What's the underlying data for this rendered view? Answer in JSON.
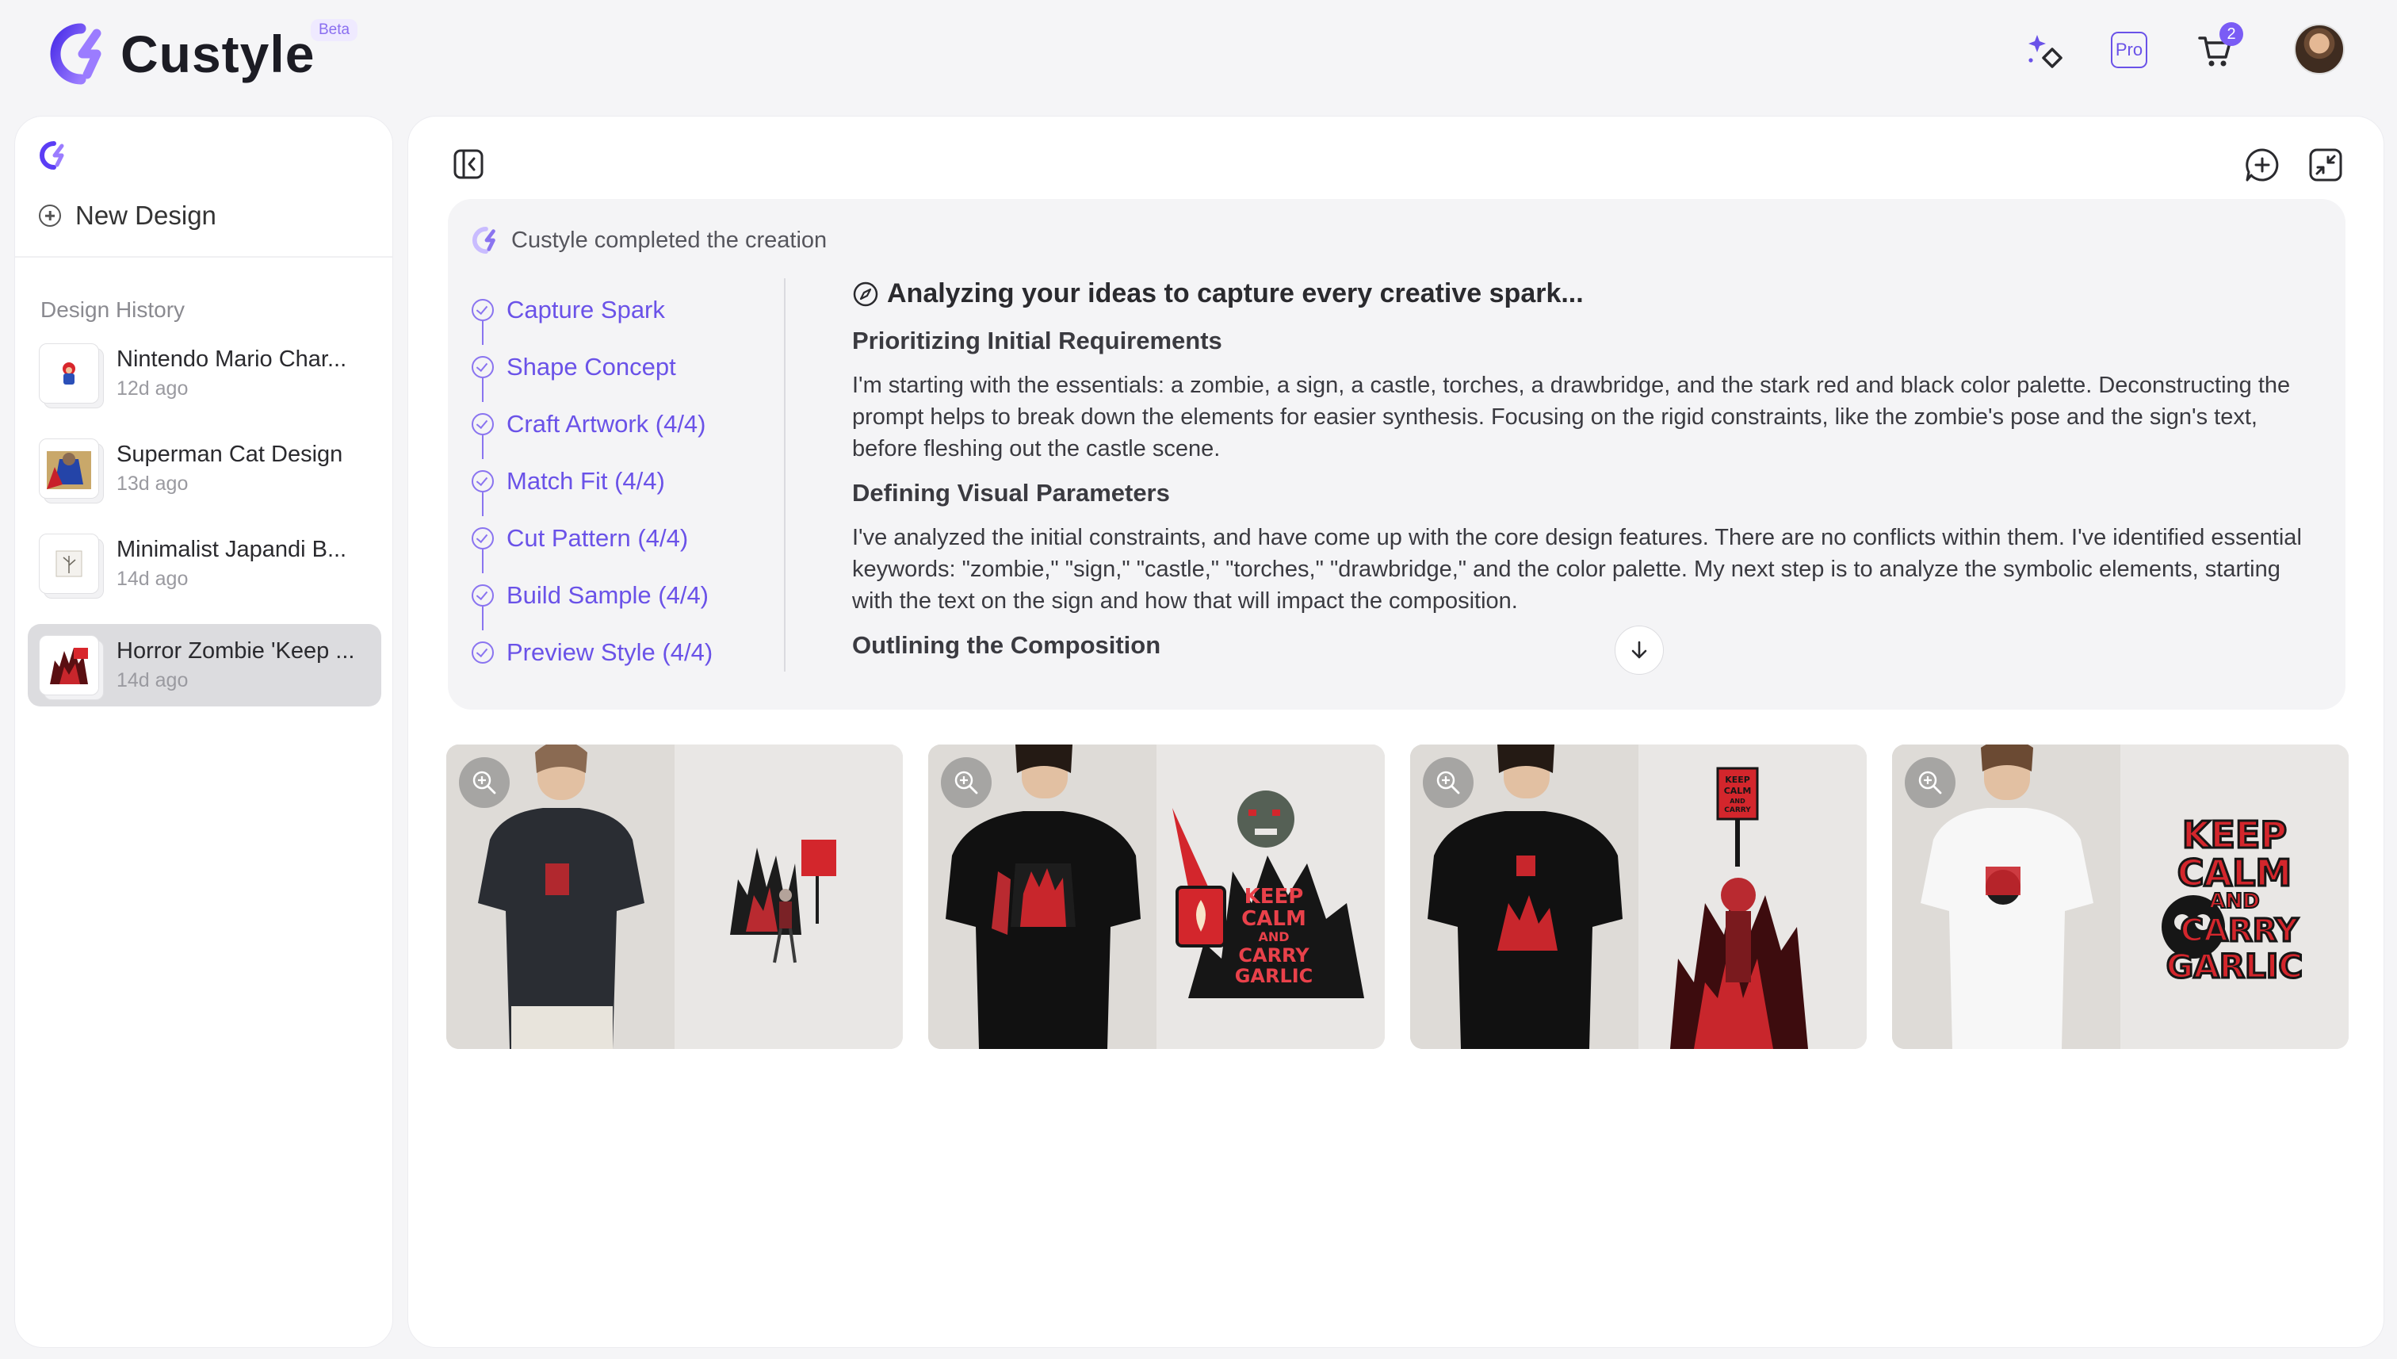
{
  "app": {
    "name": "Custyle",
    "badge": "Beta"
  },
  "header": {
    "pro_label": "Pro",
    "cart_count": "2"
  },
  "sidebar": {
    "new_design_label": "New Design",
    "history_title": "Design History",
    "items": [
      {
        "title": "Nintendo Mario Char...",
        "time": "12d ago"
      },
      {
        "title": "Superman Cat Design",
        "time": "13d ago"
      },
      {
        "title": "Minimalist Japandi B...",
        "time": "14d ago"
      },
      {
        "title": "Horror Zombie 'Keep ...",
        "time": "14d ago"
      }
    ]
  },
  "process": {
    "status": "Custyle completed the creation",
    "steps": [
      {
        "label": "Capture Spark"
      },
      {
        "label": "Shape Concept"
      },
      {
        "label": "Craft Artwork (4/4)"
      },
      {
        "label": "Match Fit (4/4)"
      },
      {
        "label": "Cut Pattern (4/4)"
      },
      {
        "label": "Build Sample (4/4)"
      },
      {
        "label": "Preview Style (4/4)"
      }
    ],
    "analysis_title": "Analyzing your ideas to capture every creative spark...",
    "sections": [
      {
        "heading": "Prioritizing Initial Requirements",
        "body": "I'm starting with the essentials: a zombie, a sign, a castle, torches, a drawbridge, and the stark red and black color palette. Deconstructing the prompt helps to break down the elements for easier synthesis. Focusing on the rigid constraints, like the zombie's pose and the sign's text, before fleshing out the castle scene."
      },
      {
        "heading": "Defining Visual Parameters",
        "body": "I've analyzed the initial constraints, and have come up with the core design features. There are no conflicts within them. I've identified essential keywords: \"zombie,\" \"sign,\" \"castle,\" \"torches,\" \"drawbridge,\" and the color palette. My next step is to analyze the symbolic elements, starting with the text on the sign and how that will impact the composition."
      },
      {
        "heading": "Outlining the Composition",
        "body": ""
      }
    ]
  },
  "results": {
    "design_text": [
      "KEEP",
      "CALM",
      "AND",
      "CARRY",
      "GARLIC"
    ]
  },
  "colors": {
    "accent": "#6a52e8",
    "brand_gradient_start": "#5b3df5",
    "brand_gradient_end": "#a98bff"
  }
}
